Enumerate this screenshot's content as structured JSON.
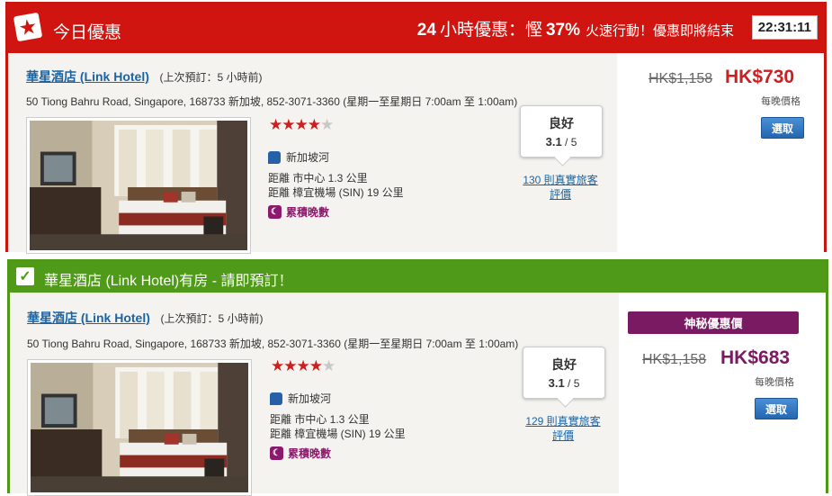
{
  "deal_card": {
    "header": {
      "title": "今日優惠",
      "promo_hours": "24",
      "promo_text": "小時優惠：慳",
      "promo_percent": "37%",
      "promo_tail": "火速行動！優惠即將結束",
      "countdown": "22:31:11"
    },
    "hotel": {
      "name": "華星酒店 (Link Hotel)",
      "last_booked": "(上次預訂：5 小時前)",
      "address": "50 Tiong Bahru Road, Singapore, 168733 新加坡, 852-3071-3360 (星期一至星期日 7:00am 至 1:00am)",
      "stars": 4,
      "location": "新加坡河",
      "distance_center": "距離 市中心 1.3 公里",
      "distance_airport": "距離 樟宜機場 (SIN) 19 公里",
      "loyalty": "累積晚數",
      "rating_label": "良好",
      "rating_score": "3.1",
      "rating_max": "/ 5",
      "reviews_line1": "130 則真實旅客",
      "reviews_line2": "評價"
    },
    "price": {
      "old": "HK$1,158",
      "new": "HK$730",
      "per_night": "每晚價格",
      "select": "選取",
      "color": "#cc1f1f"
    }
  },
  "available_card": {
    "header": {
      "title": "華星酒店 (Link Hotel)有房 - 請即預訂！"
    },
    "hotel": {
      "name": "華星酒店 (Link Hotel)",
      "last_booked": "(上次預訂：5 小時前)",
      "address": "50 Tiong Bahru Road, Singapore, 168733 新加坡, 852-3071-3360 (星期一至星期日 7:00am 至 1:00am)",
      "stars": 4,
      "location": "新加坡河",
      "distance_center": "距離 市中心 1.3 公里",
      "distance_airport": "距離 樟宜機場 (SIN) 19 公里",
      "loyalty": "累積晚數",
      "rating_label": "良好",
      "rating_score": "3.1",
      "rating_max": "/ 5",
      "reviews_line1": "129 則真實旅客",
      "reviews_line2": "評價"
    },
    "price": {
      "badge": "神秘優惠價",
      "old": "HK$1,158",
      "new": "HK$683",
      "per_night": "每晚價格",
      "select": "選取",
      "color": "#7a1a63"
    }
  },
  "colors": {
    "deal_red": "#d0140f",
    "available_green": "#4f9a18",
    "link_blue": "#1a64a6",
    "button_blue": "#2466b0"
  }
}
